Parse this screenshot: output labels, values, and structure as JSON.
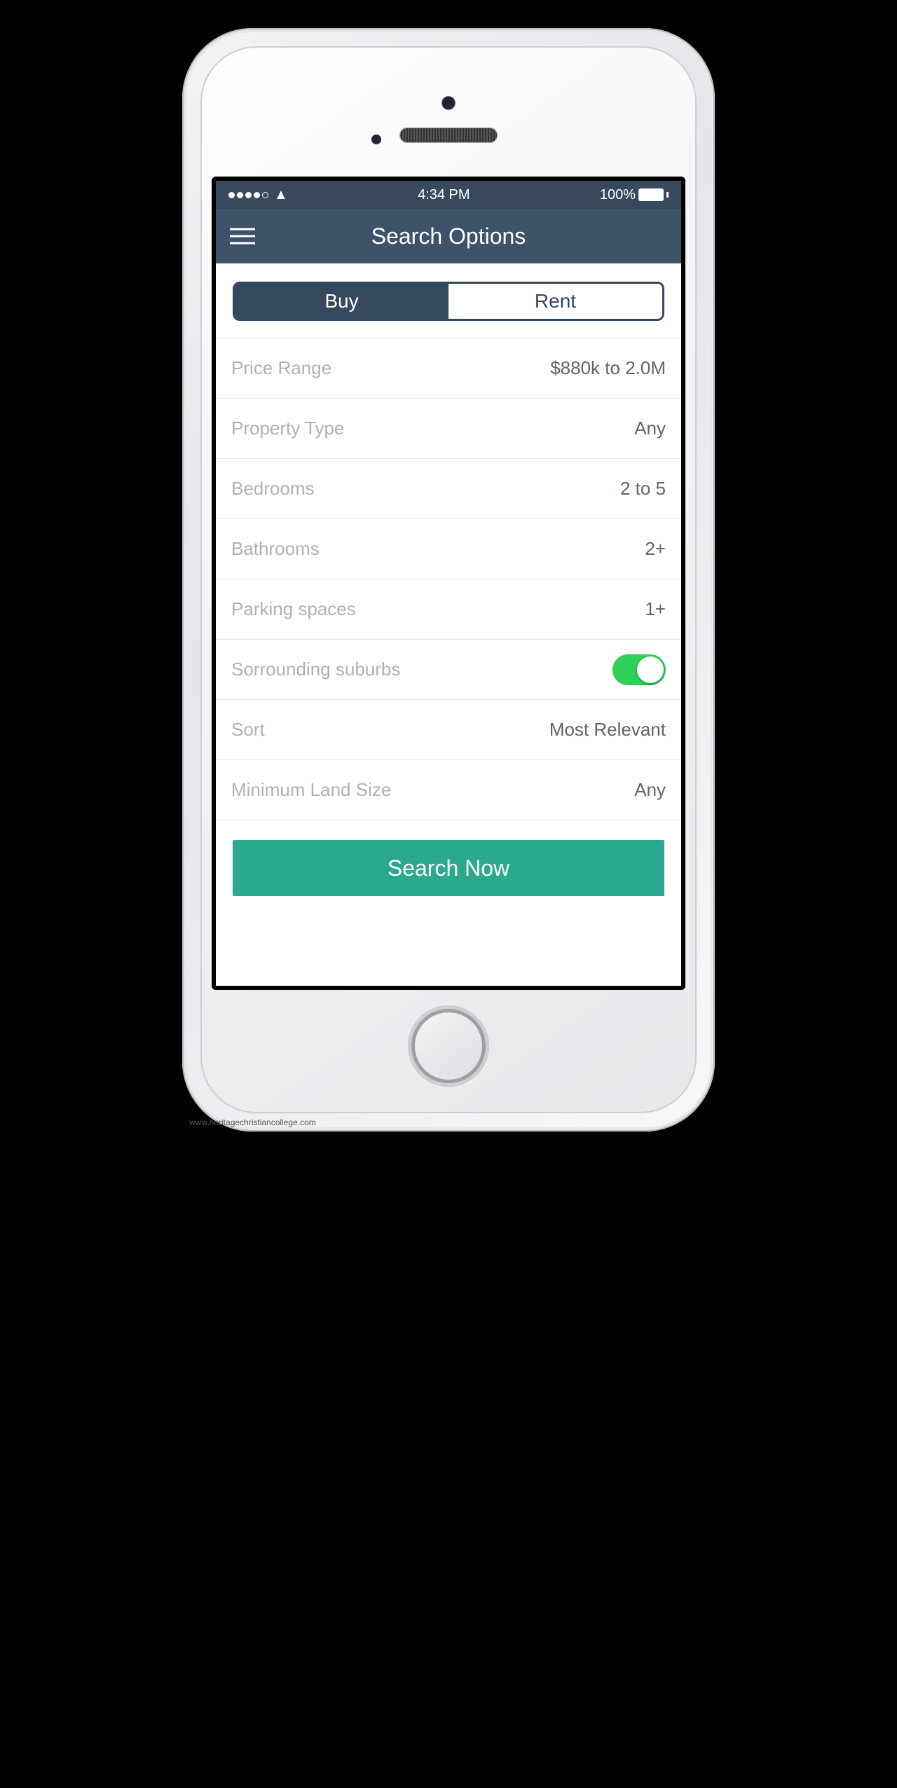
{
  "status": {
    "time": "4:34 PM",
    "battery": "100%"
  },
  "nav": {
    "title": "Search Options"
  },
  "segment": {
    "buy": "Buy",
    "rent": "Rent"
  },
  "rows": {
    "price": {
      "label": "Price Range",
      "value": "$880k to 2.0M"
    },
    "type": {
      "label": "Property Type",
      "value": "Any"
    },
    "bedrooms": {
      "label": "Bedrooms",
      "value": "2 to 5"
    },
    "bath": {
      "label": "Bathrooms",
      "value": "2+"
    },
    "park": {
      "label": "Parking spaces",
      "value": "1+"
    },
    "suburbs": {
      "label": "Sorrounding suburbs"
    },
    "sort": {
      "label": "Sort",
      "value": "Most Relevant"
    },
    "land": {
      "label": "Minimum Land Size",
      "value": "Any"
    }
  },
  "cta": {
    "label": "Search Now"
  },
  "watermark": "www.heritagechristiancollege.com"
}
